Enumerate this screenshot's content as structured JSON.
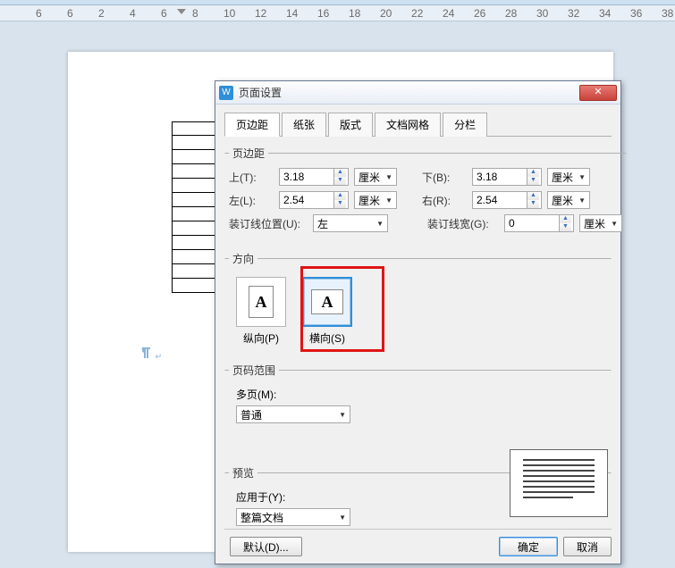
{
  "ruler": {
    "ticks": [
      "6",
      "6",
      "2",
      "4",
      "6",
      "8",
      "10",
      "12",
      "14",
      "16",
      "18",
      "20",
      "22",
      "24",
      "26",
      "28",
      "30",
      "32",
      "34",
      "36",
      "38"
    ]
  },
  "dialog": {
    "title": "页面设置",
    "tabs": [
      "页边距",
      "纸张",
      "版式",
      "文档网格",
      "分栏"
    ],
    "active_tab": 0,
    "margins": {
      "legend": "页边距",
      "top_label": "上(T):",
      "top_value": "3.18",
      "left_label": "左(L):",
      "left_value": "2.54",
      "bottom_label": "下(B):",
      "bottom_value": "3.18",
      "right_label": "右(R):",
      "right_value": "2.54",
      "unit": "厘米",
      "gutter_pos_label": "装订线位置(U):",
      "gutter_pos_value": "左",
      "gutter_width_label": "装订线宽(G):",
      "gutter_width_value": "0"
    },
    "orientation": {
      "legend": "方向",
      "portrait": "纵向(P)",
      "landscape": "横向(S)",
      "selected": "landscape"
    },
    "pagerange": {
      "legend": "页码范围",
      "multi_label": "多页(M):",
      "multi_value": "普通"
    },
    "preview": {
      "legend": "预览",
      "apply_label": "应用于(Y):",
      "apply_value": "整篇文档"
    },
    "buttons": {
      "default": "默认(D)...",
      "ok": "确定",
      "cancel": "取消"
    },
    "close_glyph": "✕"
  }
}
